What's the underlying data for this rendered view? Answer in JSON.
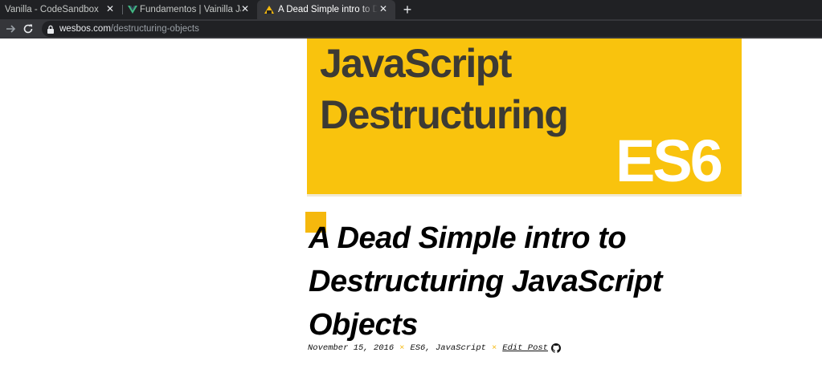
{
  "browser": {
    "tabs": [
      {
        "title": "Vanilla - CodeSandbox",
        "close": "✕",
        "favicon": "none",
        "active": false
      },
      {
        "title": "Fundamentos | Vainilla Javascript",
        "close": "✕",
        "favicon": "vue-icon",
        "active": false
      },
      {
        "title": "A Dead Simple intro to Destructuring",
        "close": "✕",
        "favicon": "wesbos-icon",
        "active": true
      }
    ],
    "new_tab": "+",
    "url_domain": "wesbos.com",
    "url_path": "/destructuring-objects",
    "colors": {
      "tabstrip": "#202124",
      "toolbar": "#35363a",
      "vue_green": "#41b883"
    }
  },
  "page": {
    "hero": {
      "line1": "JavaScript",
      "line2": "Destructuring",
      "badge": "ES6",
      "colors": {
        "background": "#f9c30d",
        "text": "#3c3a34",
        "badge": "#ffffff"
      }
    },
    "title": "A Dead Simple intro to Destructuring JavaScript Objects",
    "meta": {
      "date": "November 15, 2016",
      "separator": "×",
      "tags": "ES6, JavaScript",
      "edit_link": "Edit Post",
      "icon": "github-icon"
    },
    "accent_color": "#f5b80d"
  }
}
